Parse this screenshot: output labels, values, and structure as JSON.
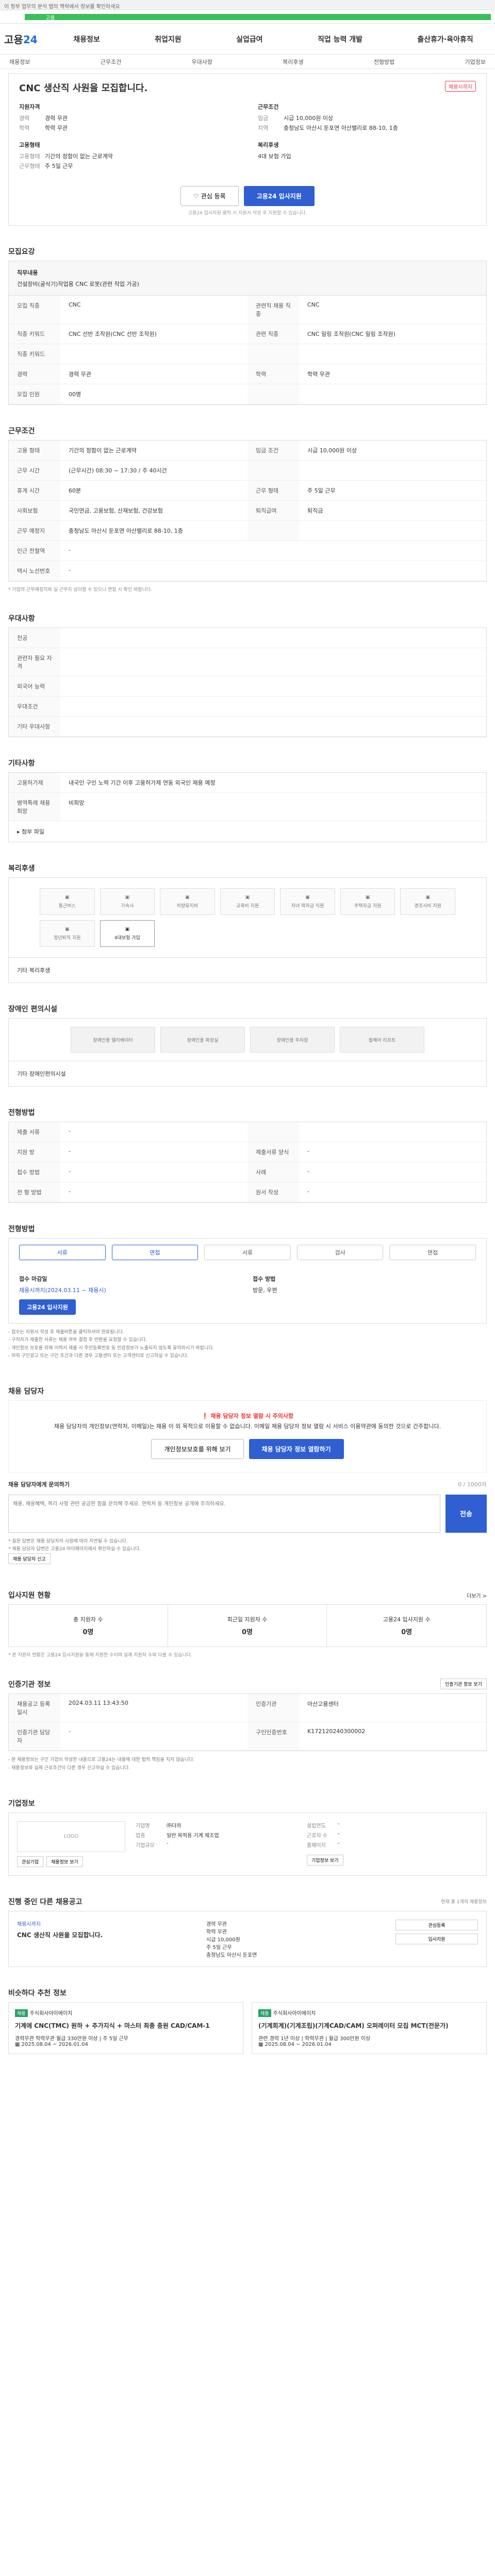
{
  "topbar": {
    "left": "이 정부 업무의 분석 탭의 맥락에서 정보를 확인하세요",
    "right": ""
  },
  "greenbar": {
    "label": "고용"
  },
  "header": {
    "logo_a": "고용",
    "logo_b": "24",
    "nav": [
      "채용정보",
      "취업지원",
      "실업급여",
      "직업 능력 개발",
      "출산휴가·육아휴직"
    ]
  },
  "subnav": [
    "채용정보",
    "근무조건",
    "우대사항",
    "복리후생",
    "전형방법",
    "기업정보"
  ],
  "summary": {
    "title": "CNC 생산직 사원을 모집합니다.",
    "badge": "채용시까지",
    "recruit_h": "지원자격",
    "recruit": [
      {
        "k": "경력",
        "v": "경력 무관"
      },
      {
        "k": "학력",
        "v": "학력 무관"
      }
    ],
    "work_h": "근무조건",
    "work": [
      {
        "k": "임금",
        "v": "시급 10,000원 이상"
      },
      {
        "k": "지역",
        "v": "충청남도 아산시 둔포면 아산밸리로 88-10, 1층"
      }
    ],
    "type_h": "고용형태",
    "type": [
      {
        "k": "고용형태",
        "v": "기간의 정함이 없는 근로계약"
      },
      {
        "k": "근무형태",
        "v": "주 5일 근무"
      }
    ],
    "welfare_h": "복리후생",
    "welfare": "4대 보험 가입",
    "btn_interest": "관심 등록",
    "btn_apply": "고용24 입사지원",
    "note": "고용24 입사지원 클릭 시 지원서 작성 후 지원할 수 있습니다."
  },
  "recruit_sec": {
    "title": "모집요강",
    "duty_h": "직무내용",
    "duty": "건설장비(굴삭기)작업용 CNC 로봇(관련 작업 가공)",
    "rows": [
      {
        "k": "모집 직종",
        "v": "CNC",
        "k2": "관련직 채용 직종",
        "v2": "CNC"
      },
      {
        "k": "직종 키워드",
        "v": "CNC 선반 조작원(CNC 선반 조작원)",
        "k2": "관련 직종",
        "v2": "CNC 밀링 조작원(CNC 밀링 조작원)"
      },
      {
        "k": "직종 키워드",
        "v": "",
        "k2": "",
        "v2": ""
      },
      {
        "k": "경력",
        "v": "경력 무관",
        "k2": "학력",
        "v2": "학력 무관"
      },
      {
        "k": "모집 인원",
        "v": "00명",
        "k2": "",
        "v2": ""
      }
    ]
  },
  "work_sec": {
    "title": "근무조건",
    "rows": [
      {
        "k": "고용 형태",
        "v": "기간의 정함이 없는 근로계약",
        "k2": "임금 조건",
        "v2": "시급 10,000원 이상"
      },
      {
        "k": "근무 시간",
        "v": "(근무시간) 08:30 ~ 17:30 / 주 40시간",
        "k2": "",
        "v2": ""
      },
      {
        "k": "휴게 시간",
        "v": "60분",
        "k2": "근무 형태",
        "v2": "주 5일 근무"
      },
      {
        "k": "사회보험",
        "v": "국민연금, 고용보험, 산재보험, 건강보험",
        "k2": "퇴직급여",
        "v2": "퇴직금"
      },
      {
        "k": "근무 예정지",
        "v": "충청남도 아산시 둔포면 아산밸리로 88-10, 1층",
        "k2": "",
        "v2": ""
      }
    ],
    "single": [
      {
        "k": "인근 전철역",
        "v": "-"
      },
      {
        "k": "택시 노선번호",
        "v": "-"
      }
    ],
    "map_btn": "지도 보기",
    "note": "* 기업의 근무예정지와 실 근무지 상이할 수 있으니 면접 시 확인 바랍니다."
  },
  "pref_sec": {
    "title": "우대사항",
    "rows": [
      {
        "k": "전공",
        "v": ""
      },
      {
        "k": "관련자 필요 자격",
        "v": ""
      },
      {
        "k": "외국어 능력",
        "v": ""
      },
      {
        "k": "우대조건",
        "v": ""
      },
      {
        "k": "기타 우대사항",
        "v": ""
      }
    ]
  },
  "etc_sec": {
    "title": "기타사항",
    "rows": [
      {
        "k": "고용허가제",
        "v": "내국인 구인 노력 기간 이후 고용허가제 연동 외국인 채용 예정"
      },
      {
        "k": "병역특례 채용 희망",
        "v": "비희망"
      }
    ],
    "attach": "첨부 파일"
  },
  "welfare_sec": {
    "title": "복리후생",
    "items": [
      "통근버스",
      "기숙사",
      "차량유지비",
      "교육비 지원",
      "자녀 학자금 지원",
      "주택자금 지원",
      "경조사비 지원",
      "정년퇴직 지원",
      "4대보험 가입"
    ],
    "note_title": "기타 복리후생"
  },
  "disab_sec": {
    "title": "장애인 편의시설",
    "items": [
      "장애인용 엘리베이터",
      "장애인용 화장실",
      "장애인용 주차장",
      "휠체어 리프트"
    ],
    "note": "기타 장애인편의시설"
  },
  "method_sec": {
    "title": "전형방법",
    "rows": [
      {
        "k": "제출 서류",
        "v": "-",
        "k2": "",
        "v2": ""
      },
      {
        "k": "지원 방",
        "v": "-",
        "k2": "제출서류 양식",
        "v2": "-"
      },
      {
        "k": "접수 방법",
        "v": "-",
        "k2": "사례",
        "v2": "-"
      },
      {
        "k": "전 형 방법",
        "v": "-",
        "k2": "원서 작성",
        "v2": "-"
      }
    ]
  },
  "process_sec": {
    "title": "전형방법",
    "steps": [
      "서류",
      "면접",
      "서류",
      "검사",
      "면접"
    ],
    "apply_h": "접수 마감일",
    "apply_v": "채용시까지(2024.03.11 ~ 채용시)",
    "apply_btn": "고용24 입사지원",
    "method_h": "접수 방법",
    "method_v": "방문, 우편",
    "bullets": [
      "- 접수는 지원서 작성 후 제출버튼을 클릭하셔야 완료됩니다.",
      "- 구직자가 제출한 서류는 채용 여부 결정 후 반환을 요청할 수 있습니다.",
      "- 개인정보 보호를 위해 이력서 제출 시 주민등록번호 등 민감정보가 노출되지 않도록 유의하시기 바랍니다.",
      "- 허위 구인광고 또는 구인 조건과 다른 경우 고용센터 또는 고객센터로 신고하실 수 있습니다."
    ]
  },
  "qa_sec": {
    "title": "채용 담당자",
    "warn_title": "채용 담당자 정보 열람 시 주의사항",
    "warn_body": "채용 담당자의 개인정보(연락처, 이메일)는 채용 이 외 목적으로 이용할 수 없습니다. 이메일 채용 담당자 정보 열람 시 서비스 이용약관에 동의한 것으로 간주합니다.",
    "btn_a": "개인정보보호를 위해 보기",
    "btn_b": "채용 담당자 정보 열람하기",
    "input_label": "채용 담당자에게 문의하기",
    "counter": "0 / 1000자",
    "placeholder": "채용, 채용혜택, 복리 사항 관련 궁금한 점을 문의해 주세요. 연락처 등 개인정보 공개에 주의하세요.",
    "send": "전송",
    "notes": [
      "* 질문 답변은 채용 담당자의 사정에 따라 지연될 수 있습니다.",
      "* 채용 담당자 답변은 고용24 마이페이지에서 확인하실 수 있습니다."
    ],
    "report_btn": "채용 담당자 신고"
  },
  "stat_sec": {
    "title": "입사지원 현황",
    "more": "더보기 >",
    "items": [
      {
        "k": "총 지원자 수",
        "v": "0명"
      },
      {
        "k": "최근일 지원자 수",
        "v": "0명"
      },
      {
        "k": "고용24 입사지원 수",
        "v": "0명"
      }
    ],
    "note": "* 본 지원자 현황은 고용24 입사지원을 통해 지원한 수이며 실제 지원자 수와 다를 수 있습니다."
  },
  "agency_sec": {
    "title": "인증기관 정보",
    "btn": "인증기관 정보 보기",
    "rows": [
      {
        "k": "채용공고 등록일시",
        "v": "2024.03.11 13:43:50",
        "k2": "인증기관",
        "v2": "아산고용센터"
      },
      {
        "k": "인증기관 담당자",
        "v": "-",
        "k2": "구인인증번호",
        "v2": "K172120240300002"
      }
    ],
    "bullets": [
      "- 본 채용정보는 구인 기업이 작성한 내용으로 고용24는 내용에 대한 법적 책임을 지지 않습니다.",
      "- 채용정보와 실제 근로조건이 다른 경우 신고하실 수 있습니다."
    ]
  },
  "company_sec": {
    "title": "기업정보",
    "logo": "LOGO",
    "btn_a": "관심기업",
    "btn_b": "채용정보 보기",
    "btn_more": "기업정보 보기",
    "rows": [
      {
        "k": "기업명",
        "v": "㈜더하"
      },
      {
        "k": "업종",
        "v": "일반 목적용 기계 제조업"
      },
      {
        "k": "기업규모",
        "v": "-"
      }
    ],
    "rows2": [
      {
        "k": "설립연도",
        "v": "-"
      },
      {
        "k": "근로자 수",
        "v": "-"
      },
      {
        "k": "홈페이지",
        "v": "-"
      }
    ]
  },
  "other_sec": {
    "title": "진행 중인 다른 채용공고",
    "right": "현재 총 1개의 채용정보",
    "tag": "채용시까지",
    "job": "CNC 생산직 사원을 모집합니다.",
    "meta": [
      "경력 무관",
      "학력 무관",
      "시급 10,000원",
      "주 5일 근무",
      "충청남도 아산시 둔포면"
    ],
    "btns": [
      "관심등록",
      "입사지원"
    ]
  },
  "similar_sec": {
    "title": "비슷하다 추천 정보",
    "cards": [
      {
        "tag": "채용",
        "co": "주식회사아이에이치",
        "title": "기계에 CNC(TMC) 원하 + 추가지식 + 마스터 최종 충원 CAD/CAM-1",
        "meta": "경력무관 학력무관 월급 330만원 이상 | 주 5일 근무",
        "date": "2025.08.04 ~ 2026.01.04"
      },
      {
        "tag": "채용",
        "co": "주식회사아이에이치",
        "title": "(기계회계)(기계조립)(기계CAD/CAM) 오퍼레이터 모집 MCT(전문가)",
        "meta": "관련 경력 1년 이상 | 학력무관 | 월급 300만원 이상",
        "date": "2025.08.04 ~ 2026.01.04"
      }
    ]
  }
}
